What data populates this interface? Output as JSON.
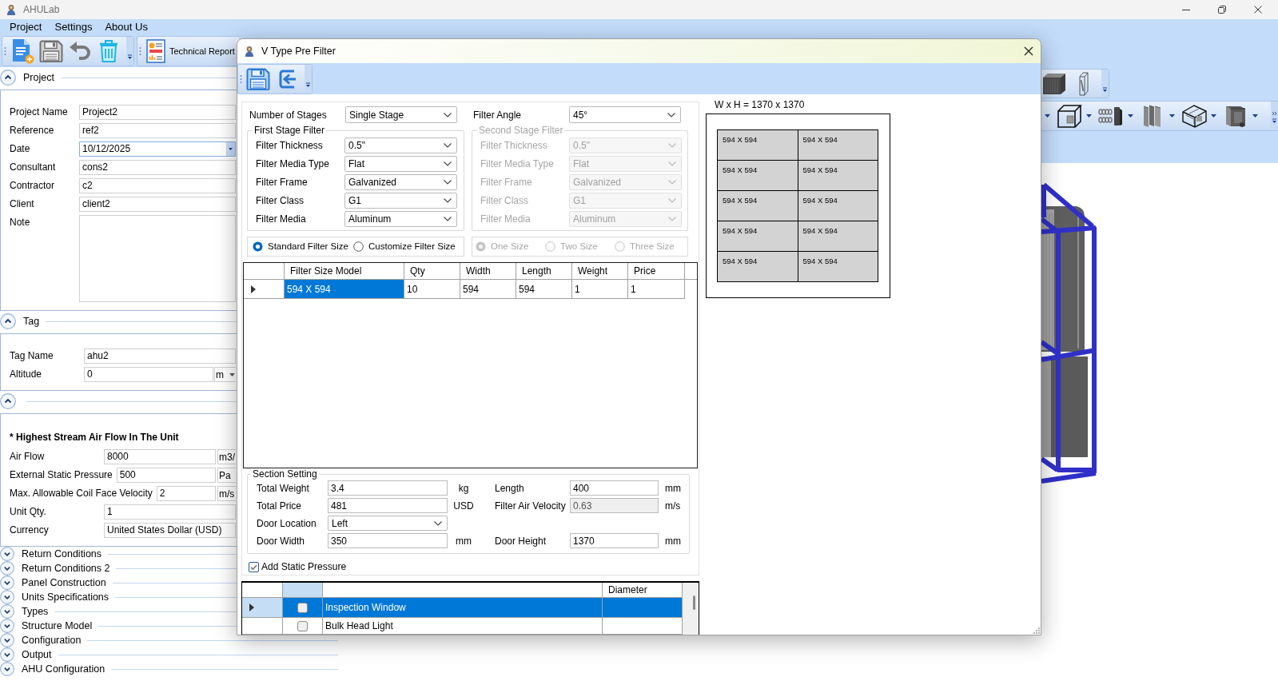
{
  "window": {
    "title": "AHULab"
  },
  "menu": [
    {
      "label": "Project"
    },
    {
      "label": "Settings"
    },
    {
      "label": "About Us"
    }
  ],
  "toolbar": {
    "report_button": "Technical Report"
  },
  "sidebar": {
    "sections": [
      {
        "title": "Project",
        "expanded": true,
        "fields": [
          {
            "kind": "text",
            "label": "Project Name",
            "value": "Project2"
          },
          {
            "kind": "text",
            "label": "Reference",
            "value": "ref2"
          },
          {
            "kind": "date",
            "label": "Date",
            "value": "10/12/2025"
          },
          {
            "kind": "text",
            "label": "Consultant",
            "value": "cons2"
          },
          {
            "kind": "text",
            "label": "Contractor",
            "value": "c2"
          },
          {
            "kind": "text",
            "label": "Client",
            "value": "client2"
          },
          {
            "kind": "memo",
            "label": "Note"
          }
        ]
      },
      {
        "title": "Tag",
        "expanded": true,
        "fields": [
          {
            "kind": "text",
            "label": "Tag Name",
            "value": "ahu2"
          },
          {
            "kind": "text",
            "label": "Altitude",
            "value": "0",
            "unit": "m"
          }
        ]
      },
      {
        "expanded": true,
        "note": "* Highest Stream Air Flow In The Unit",
        "fields": [
          {
            "kind": "text",
            "label": "Air Flow",
            "value": "8000",
            "unit": "m3/"
          },
          {
            "kind": "text",
            "label": "External Static Pressure",
            "value": "500",
            "unit": "Pa"
          },
          {
            "kind": "text",
            "label": "Max. Allowable Coil Face Velocity",
            "value": "2",
            "unit": "m/s"
          },
          {
            "kind": "text",
            "label": "Unit Qty.",
            "value": "1"
          },
          {
            "kind": "text",
            "label": "Currency",
            "value": "United States Dollar (USD)"
          }
        ]
      },
      {
        "title": "Return Conditions",
        "expanded": false
      },
      {
        "title": "Return Conditions 2",
        "expanded": false
      },
      {
        "title": "Panel Construction",
        "expanded": false
      },
      {
        "title": "Units Specifications",
        "expanded": false
      },
      {
        "title": "Types",
        "expanded": false
      },
      {
        "title": "Structure Model",
        "expanded": false
      },
      {
        "title": "Configuration",
        "expanded": false
      },
      {
        "title": "Output",
        "expanded": false
      },
      {
        "title": "AHU Configuration",
        "expanded": false
      }
    ]
  },
  "dialog": {
    "title": "V Type Pre Filter",
    "number_of_stages": {
      "label": "Number of Stages",
      "value": "Single Stage"
    },
    "filter_angle": {
      "label": "Filter Angle",
      "value": "45°"
    },
    "stage_groups": [
      {
        "title": "First Stage Filter",
        "disabled": false,
        "fields": [
          {
            "label": "Filter Thickness",
            "value": "0.5\""
          },
          {
            "label": "Filter Media Type",
            "value": "Flat"
          },
          {
            "label": "Filter Frame",
            "value": "Galvanized"
          },
          {
            "label": "Filter Class",
            "value": "G1"
          },
          {
            "label": "Filter Media",
            "value": "Aluminum"
          }
        ]
      },
      {
        "title": "Second Stage Filter",
        "disabled": true,
        "fields": [
          {
            "label": "Filter Thickness",
            "value": "0.5\""
          },
          {
            "label": "Filter Media Type",
            "value": "Flat"
          },
          {
            "label": "Filter Frame",
            "value": "Galvanized"
          },
          {
            "label": "Filter Class",
            "value": "G1"
          },
          {
            "label": "Filter Media",
            "value": "Aluminum"
          }
        ]
      }
    ],
    "radio_groups": [
      {
        "disabled": false,
        "options": [
          {
            "label": "Standard Filter Size",
            "selected": true
          },
          {
            "label": "Customize Filter Size",
            "selected": false
          }
        ]
      },
      {
        "disabled": true,
        "options": [
          {
            "label": "One Size",
            "selected": true
          },
          {
            "label": "Two Size",
            "selected": false
          },
          {
            "label": "Three Size",
            "selected": false
          }
        ]
      }
    ],
    "sizes_table": {
      "columns": [
        "Filter Size Model",
        "Qty",
        "Width",
        "Length",
        "Weight",
        "Price"
      ],
      "rows": [
        {
          "current": true,
          "cells": [
            {
              "text": "594 X 594",
              "selected": true
            },
            {
              "text": "10",
              "selected": false
            },
            {
              "text": "594",
              "selected": false
            },
            {
              "text": "594",
              "selected": false
            },
            {
              "text": "1",
              "selected": false
            },
            {
              "text": "1",
              "selected": false
            }
          ]
        }
      ]
    },
    "section_setting": {
      "title": "Section Setting",
      "rows": [
        [
          {
            "kind": "text",
            "label": "Total Weight",
            "value": "3.4",
            "unit": "kg"
          },
          {
            "kind": "text",
            "label": "Length",
            "value": "400",
            "unit": "mm"
          }
        ],
        [
          {
            "kind": "text",
            "label": "Total Price",
            "value": "481",
            "unit": "USD"
          },
          {
            "kind": "readonly",
            "label": "Filter Air Velocity",
            "value": "0.63",
            "unit": "m/s"
          }
        ],
        [
          {
            "kind": "combo",
            "label": "Door Location",
            "value": "Left"
          }
        ],
        [
          {
            "kind": "text",
            "label": "Door Width",
            "value": "350",
            "unit": "mm"
          },
          {
            "kind": "text",
            "label": "Door Height",
            "value": "1370",
            "unit": "mm"
          }
        ]
      ]
    },
    "add_static_pressure": {
      "label": "Add Static Pressure",
      "checked": true
    },
    "accessories_table": {
      "columns": [
        {
          "kind": "check",
          "selected": true
        },
        {
          "kind": "name",
          "selected": false
        },
        {
          "kind": "diameter",
          "label": "Diameter",
          "selected": false
        }
      ],
      "rows": [
        {
          "current": true,
          "selected": true,
          "checked": false,
          "name": "Inspection Window"
        },
        {
          "current": false,
          "selected": false,
          "checked": false,
          "name": "Bulk Head Light"
        }
      ]
    },
    "preview": {
      "caption": "W x H = 1370 x 1370",
      "rows": [
        [
          "594 X 594",
          "594 X 594"
        ],
        [
          "594 X 594",
          "594 X 594"
        ],
        [
          "594 X 594",
          "594 X 594"
        ],
        [
          "594 X 594",
          "594 X 594"
        ],
        [
          "594 X 594",
          "594 X 594"
        ]
      ]
    }
  }
}
